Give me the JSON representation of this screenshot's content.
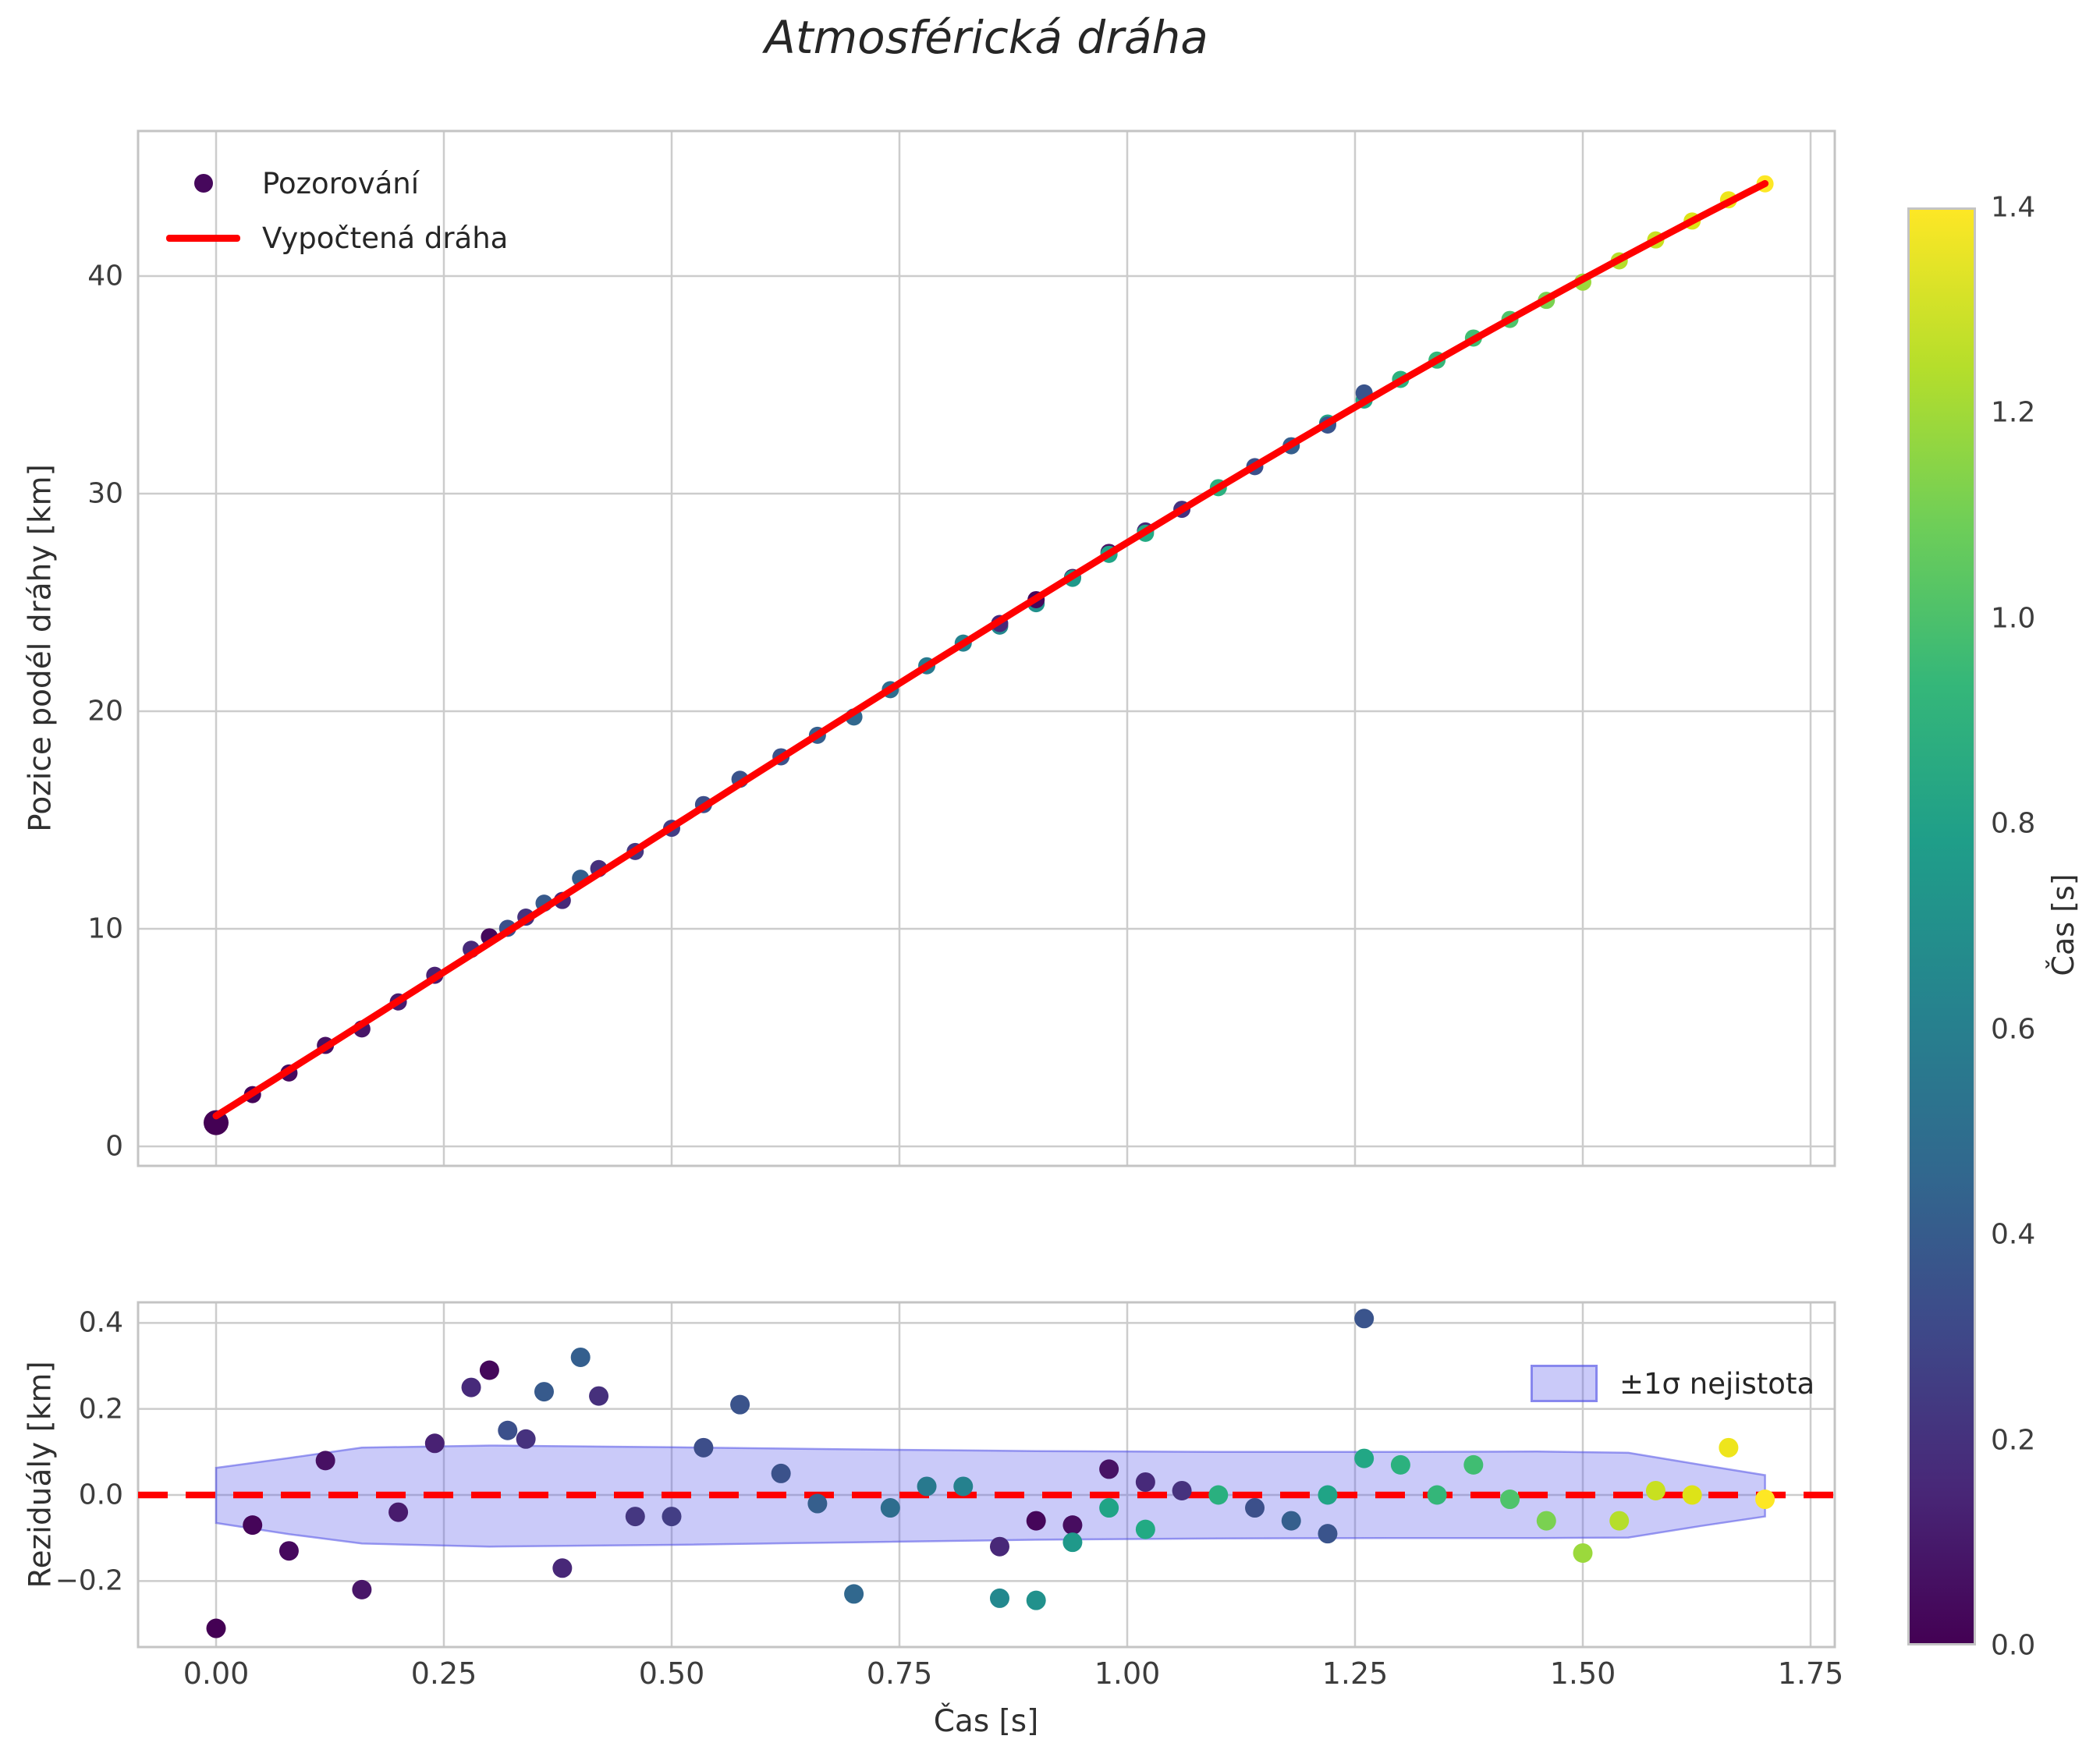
{
  "title": "Atmosférická dráha",
  "top_plot": {
    "ylabel": "Pozice podél dráhy [km]",
    "ytick_values": [
      0,
      10,
      20,
      30,
      40
    ],
    "ytick_labels": [
      "0",
      "10",
      "20",
      "30",
      "40"
    ],
    "legend": {
      "observations": "Pozorování",
      "fitted": "Vypočtená dráha"
    }
  },
  "bottom_plot": {
    "ylabel": "Reziduály [km]",
    "xlabel": "Čas [s]",
    "ytick_values": [
      0.4,
      0.2,
      0.0,
      -0.2
    ],
    "ytick_labels": [
      "0.4",
      "0.2",
      "0.0",
      "−0.2"
    ],
    "xtick_values": [
      0.0,
      0.25,
      0.5,
      0.75,
      1.0,
      1.25,
      1.5,
      1.75
    ],
    "xtick_labels": [
      "0.00",
      "0.25",
      "0.50",
      "0.75",
      "1.00",
      "1.25",
      "1.50",
      "1.75"
    ],
    "band_legend_label": "±1σ nejistota",
    "zero_line_color": "#ff0000"
  },
  "colorbar": {
    "label": "Čas [s]",
    "colormap": "viridis",
    "min": 0.0,
    "max": 1.4,
    "tick_values": [
      0.0,
      0.2,
      0.4,
      0.6,
      0.8,
      1.0,
      1.2,
      1.4
    ],
    "tick_labels": [
      "0.0",
      "0.2",
      "0.4",
      "0.6",
      "0.8",
      "1.0",
      "1.2",
      "1.4"
    ]
  },
  "colors": {
    "fit_line": "#ff0000",
    "grid": "#cccccc",
    "spine": "#c4c4c4",
    "band_fill": "rgba(90,90,235,0.32)",
    "band_edge": "rgba(80,80,230,0.55)"
  },
  "chart_data": [
    {
      "type": "scatter",
      "title": "Atmosférická dráha",
      "xlabel": "Čas [s]",
      "ylabel": "Pozice podél dráhy [km]",
      "xlim": [
        -0.086,
        1.777
      ],
      "ylim": [
        -0.9,
        46.7
      ],
      "grid": true,
      "legend_position": "upper left",
      "series": [
        {
          "name": "Pozorování",
          "note": "observations: [time_s, residual_km, point_color]; position_km = fit(t) + residual",
          "points": [
            [
              0.0,
              -0.31,
              "#440154"
            ],
            [
              0.04,
              -0.07,
              "#450559"
            ],
            [
              0.08,
              -0.13,
              "#46095d"
            ],
            [
              0.12,
              0.08,
              "#471063"
            ],
            [
              0.16,
              -0.22,
              "#481668"
            ],
            [
              0.2,
              -0.04,
              "#481b6d"
            ],
            [
              0.24,
              0.12,
              "#482173"
            ],
            [
              0.28,
              0.25,
              "#472a7a"
            ],
            [
              0.3,
              0.29,
              "#45085b"
            ],
            [
              0.32,
              0.15,
              "#3c508b"
            ],
            [
              0.34,
              0.13,
              "#46327e"
            ],
            [
              0.36,
              0.24,
              "#375a8c"
            ],
            [
              0.38,
              -0.17,
              "#482878"
            ],
            [
              0.4,
              0.32,
              "#345f8e"
            ],
            [
              0.42,
              0.23,
              "#46307c"
            ],
            [
              0.46,
              -0.05,
              "#453781"
            ],
            [
              0.5,
              -0.05,
              "#433e85"
            ],
            [
              0.535,
              0.11,
              "#3d4e8a"
            ],
            [
              0.575,
              0.21,
              "#3a538b"
            ],
            [
              0.62,
              0.05,
              "#3b528b"
            ],
            [
              0.66,
              -0.02,
              "#365f8d"
            ],
            [
              0.7,
              -0.23,
              "#31688e"
            ],
            [
              0.74,
              -0.03,
              "#2e6d8e"
            ],
            [
              0.78,
              0.02,
              "#28798e"
            ],
            [
              0.82,
              0.02,
              "#25818e"
            ],
            [
              0.86,
              -0.24,
              "#23888e"
            ],
            [
              0.86,
              -0.12,
              "#482878"
            ],
            [
              0.9,
              -0.245,
              "#21918c"
            ],
            [
              0.9,
              -0.06,
              "#45065a"
            ],
            [
              0.94,
              -0.07,
              "#470d60"
            ],
            [
              0.94,
              -0.11,
              "#1f998a"
            ],
            [
              0.98,
              0.06,
              "#471365"
            ],
            [
              0.98,
              -0.03,
              "#20a486"
            ],
            [
              1.02,
              0.03,
              "#472a7a"
            ],
            [
              1.02,
              -0.08,
              "#22aa83"
            ],
            [
              1.06,
              0.01,
              "#46327e"
            ],
            [
              1.1,
              0.0,
              "#2ab07f"
            ],
            [
              1.14,
              -0.03,
              "#3c508b"
            ],
            [
              1.18,
              -0.06,
              "#355f8d"
            ],
            [
              1.22,
              0.0,
              "#20a486"
            ],
            [
              1.22,
              -0.09,
              "#3a548c"
            ],
            [
              1.26,
              0.085,
              "#22a785"
            ],
            [
              1.26,
              0.41,
              "#3a548c"
            ],
            [
              1.3,
              0.07,
              "#2cb17e"
            ],
            [
              1.34,
              0.0,
              "#34b679"
            ],
            [
              1.38,
              0.07,
              "#40bd72"
            ],
            [
              1.42,
              -0.01,
              "#4ec36b"
            ],
            [
              1.46,
              -0.06,
              "#7ad151"
            ],
            [
              1.5,
              -0.135,
              "#9bd93c"
            ],
            [
              1.54,
              -0.06,
              "#b5de2b"
            ],
            [
              1.58,
              0.01,
              "#c8e020"
            ],
            [
              1.62,
              0.0,
              "#dde318"
            ],
            [
              1.66,
              0.11,
              "#eee51c"
            ],
            [
              1.7,
              -0.01,
              "#fde725"
            ]
          ]
        },
        {
          "name": "Vypočtená dráha",
          "type": "line",
          "color": "#ff0000",
          "fit_poly_km": [
            1.4,
            26.2,
            1.2,
            -1.05
          ],
          "t_range": [
            0.0,
            1.7
          ],
          "anchor_points": [
            [
              0.0,
              1.4
            ],
            [
              0.25,
              8.3
            ],
            [
              0.5,
              14.8
            ],
            [
              0.75,
              21.0
            ],
            [
              1.0,
              27.8
            ],
            [
              1.25,
              34.2
            ],
            [
              1.5,
              40.2
            ],
            [
              1.7,
              44.2
            ]
          ]
        }
      ]
    },
    {
      "type": "scatter",
      "ylabel": "Reziduály [km]",
      "xlabel": "Čas [s]",
      "xlim": [
        -0.086,
        1.777
      ],
      "ylim": [
        -0.355,
        0.448
      ],
      "grid": true,
      "zero_line": {
        "y": 0.0,
        "color": "#ff0000",
        "style": "dashed"
      },
      "points_source": "same [t, residual, color] triplets as top chart series Pozorování",
      "band": {
        "name": "±1σ nejistota",
        "t": [
          0.0,
          0.08,
          0.16,
          0.3,
          0.5,
          0.7,
          0.9,
          1.1,
          1.3,
          1.45,
          1.55,
          1.63,
          1.7
        ],
        "upper": [
          0.063,
          0.086,
          0.11,
          0.115,
          0.111,
          0.106,
          0.102,
          0.1,
          0.1,
          0.101,
          0.098,
          0.07,
          0.046
        ],
        "lower": [
          -0.065,
          -0.091,
          -0.113,
          -0.12,
          -0.116,
          -0.11,
          -0.104,
          -0.101,
          -0.1,
          -0.1,
          -0.099,
          -0.072,
          -0.05
        ]
      }
    }
  ]
}
